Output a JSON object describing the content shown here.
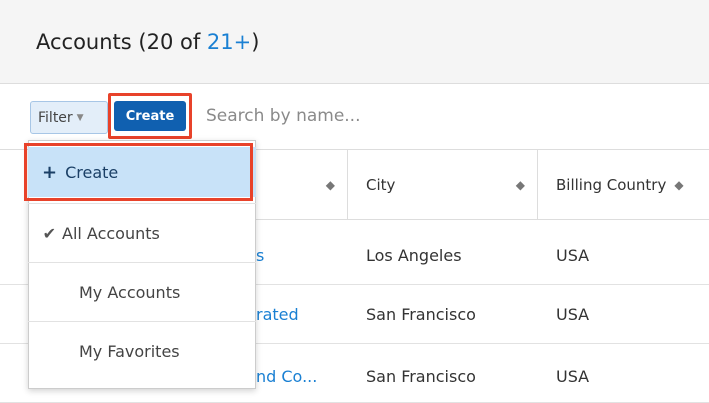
{
  "header": {
    "title_prefix": "Accounts (20 of ",
    "count_link": "21+",
    "title_suffix": ")"
  },
  "toolbar": {
    "filter_label": "Filter",
    "create_label": "Create",
    "search_placeholder": "Search by name..."
  },
  "dropdown": {
    "create_label": "Create",
    "items": [
      {
        "label": "All Accounts",
        "checked": true
      },
      {
        "label": "My Accounts",
        "checked": false
      },
      {
        "label": "My Favorites",
        "checked": false
      }
    ]
  },
  "table": {
    "columns": [
      "City",
      "Billing Country"
    ],
    "rows": [
      {
        "name_fragment": "s",
        "city": "Los Angeles",
        "country": "USA"
      },
      {
        "name_fragment": "rated",
        "city": "San Francisco",
        "country": "USA"
      },
      {
        "name_fragment": "nd Co...",
        "city": "San Francisco",
        "country": "USA"
      }
    ]
  },
  "colors": {
    "accent": "#1a80d3",
    "primary_button": "#1060b0",
    "highlight": "#e8422a",
    "selected_item": "#c8e2f8"
  },
  "icons": [
    "plus-icon",
    "checkmark-icon",
    "sort-icon",
    "caret-down-icon"
  ]
}
